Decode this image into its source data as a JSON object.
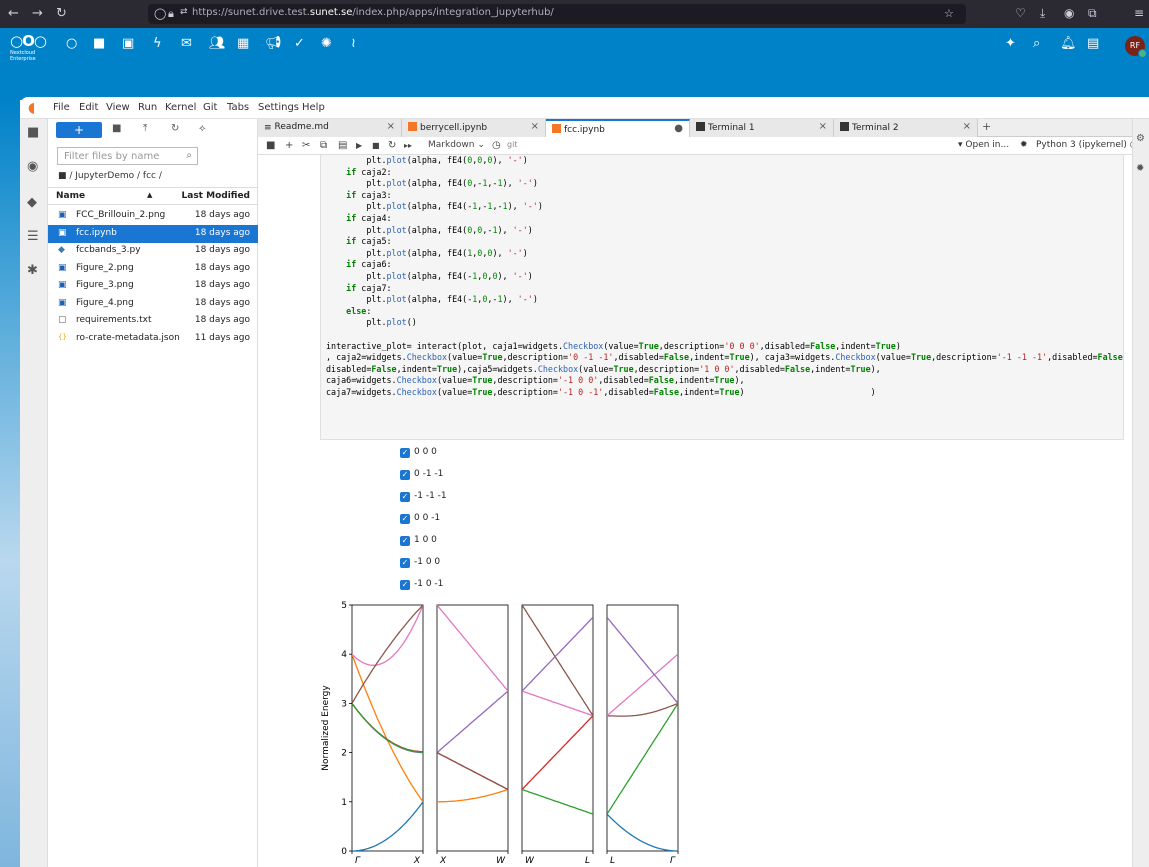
{
  "browser": {
    "url_prefix": "https://sunet.drive.test.",
    "url_domain": "sunet.se",
    "url_suffix": "/index.php/apps/integration_jupyterhub/"
  },
  "nextcloud": {
    "logo_sub1": "Nextcloud",
    "logo_sub2": "Enterprise",
    "avatar": "RF",
    "brand_color": "#0082c9"
  },
  "menu": [
    "File",
    "Edit",
    "View",
    "Run",
    "Kernel",
    "Git",
    "Tabs",
    "Settings",
    "Help"
  ],
  "filebrowser": {
    "new_label": "+",
    "filter_placeholder": "Filter files by name",
    "breadcrumb": "/ JupyterDemo / fcc /",
    "col_name": "Name",
    "col_modified": "Last Modified",
    "files": [
      {
        "name": "FCC_Brillouin_2.png",
        "date": "18 days ago",
        "icon": "image-icon"
      },
      {
        "name": "fcc.ipynb",
        "date": "18 days ago",
        "icon": "notebook-icon",
        "selected": true
      },
      {
        "name": "fccbands_3.py",
        "date": "18 days ago",
        "icon": "python-icon"
      },
      {
        "name": "Figure_2.png",
        "date": "18 days ago",
        "icon": "image-icon"
      },
      {
        "name": "Figure_3.png",
        "date": "18 days ago",
        "icon": "image-icon"
      },
      {
        "name": "Figure_4.png",
        "date": "18 days ago",
        "icon": "image-icon"
      },
      {
        "name": "requirements.txt",
        "date": "18 days ago",
        "icon": "text-file-icon"
      },
      {
        "name": "ro-crate-metadata.json",
        "date": "11 days ago",
        "icon": "json-icon"
      }
    ]
  },
  "tabs": [
    {
      "label": "Readme.md",
      "icon": "markdown-icon"
    },
    {
      "label": "berrycell.ipynb",
      "icon": "notebook-icon"
    },
    {
      "label": "fcc.ipynb",
      "icon": "notebook-icon",
      "active": true
    },
    {
      "label": "Terminal 1",
      "icon": "terminal-icon"
    },
    {
      "label": "Terminal 2",
      "icon": "terminal-icon"
    }
  ],
  "notebook_toolbar": {
    "cell_type": "Markdown",
    "git": "git",
    "open_in": "Open in...",
    "kernel": "Python 3 (ipykernel)"
  },
  "checkboxes": [
    "0 0 0",
    "0 -1 -1",
    "-1 -1 -1",
    "0 0 -1",
    "1 0 0",
    "-1 0 0",
    "-1 0 -1"
  ],
  "chart_data": {
    "type": "line",
    "ylabel": "Normalized Energy",
    "ylim": [
      0,
      5
    ],
    "yticks": [
      0,
      1,
      2,
      3,
      4,
      5
    ],
    "panels": [
      {
        "left_label": "Γ",
        "right_label": "X"
      },
      {
        "left_label": "X",
        "right_label": "W"
      },
      {
        "left_label": "W",
        "right_label": "L"
      },
      {
        "left_label": "L",
        "right_label": "Γ"
      }
    ],
    "colors": {
      "blue": "#1f77b4",
      "orange": "#ff7f0e",
      "green": "#2ca02c",
      "red": "#d62728",
      "purple": "#9467bd",
      "brown": "#8c564b",
      "pink": "#e377c2"
    }
  }
}
